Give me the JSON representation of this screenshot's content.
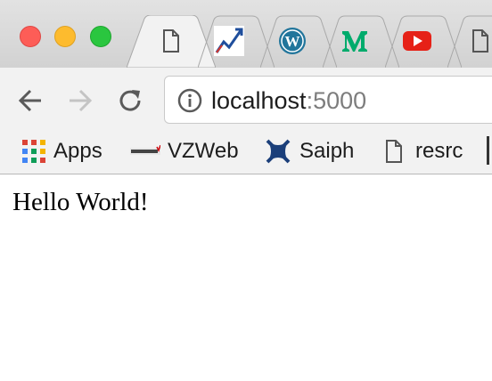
{
  "window": {
    "traffic_lights": {
      "close": "#fd5d57",
      "minimize": "#fdbb2e",
      "maximize": "#2ac63f"
    }
  },
  "tabs": [
    {
      "icon": "blank-page-icon",
      "active": true
    },
    {
      "icon": "trend-chart-icon"
    },
    {
      "icon": "wordpress-icon",
      "color": "#21759b"
    },
    {
      "icon": "medium-icon",
      "color": "#00ab6c"
    },
    {
      "icon": "youtube-icon",
      "color": "#e62117"
    },
    {
      "icon": "blank-page-icon"
    }
  ],
  "toolbar": {
    "back_icon": "arrow-left-icon",
    "forward_icon": "arrow-right-icon",
    "reload_icon": "reload-icon",
    "info_icon": "info-icon",
    "url_host": "localhost",
    "url_port": ":5000"
  },
  "bookmarks": [
    {
      "label": "Apps",
      "icon": "apps-grid-icon"
    },
    {
      "label": "VZWeb",
      "icon": "verizon-logo-icon"
    },
    {
      "label": "Saiph",
      "icon": "saiph-logo-icon"
    },
    {
      "label": "resrc",
      "icon": "blank-page-icon"
    }
  ],
  "page": {
    "text": "Hello World!"
  }
}
